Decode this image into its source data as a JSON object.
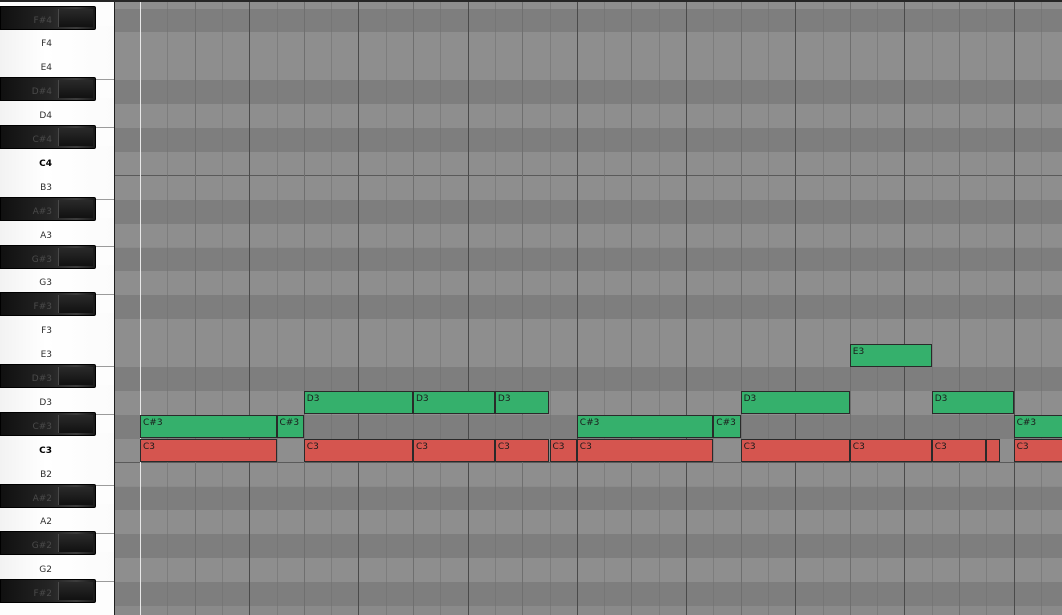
{
  "colors": {
    "note_green": "#35b06c",
    "note_red": "#d5554f",
    "grid_light": "#8e8e8e",
    "grid_dark": "#7e7e7e"
  },
  "keyboard": {
    "keys": [
      {
        "label": "F#4",
        "black": true
      },
      {
        "label": "F4",
        "black": false
      },
      {
        "label": "E4",
        "black": false
      },
      {
        "label": "D#4",
        "black": true
      },
      {
        "label": "D4",
        "black": false
      },
      {
        "label": "C#4",
        "black": true
      },
      {
        "label": "C4",
        "black": false
      },
      {
        "label": "B3",
        "black": false
      },
      {
        "label": "A#3",
        "black": true
      },
      {
        "label": "A3",
        "black": false
      },
      {
        "label": "G#3",
        "black": true
      },
      {
        "label": "G3",
        "black": false
      },
      {
        "label": "F#3",
        "black": true
      },
      {
        "label": "F3",
        "black": false
      },
      {
        "label": "E3",
        "black": false
      },
      {
        "label": "D#3",
        "black": true
      },
      {
        "label": "D3",
        "black": false
      },
      {
        "label": "C#3",
        "black": true
      },
      {
        "label": "C3",
        "black": false
      },
      {
        "label": "B2",
        "black": false
      },
      {
        "label": "A#2",
        "black": true
      },
      {
        "label": "A2",
        "black": false
      },
      {
        "label": "G#2",
        "black": true
      },
      {
        "label": "G2",
        "black": false
      },
      {
        "label": "F#2",
        "black": true
      }
    ]
  },
  "notes": [
    {
      "pitch": "E3",
      "start": 13,
      "length": 1.5,
      "color": "green"
    },
    {
      "pitch": "D3",
      "start": 3,
      "length": 2,
      "color": "green"
    },
    {
      "pitch": "D3",
      "start": 5,
      "length": 1.5,
      "color": "green"
    },
    {
      "pitch": "D3",
      "start": 6.5,
      "length": 1,
      "color": "green"
    },
    {
      "pitch": "D3",
      "start": 11,
      "length": 2,
      "color": "green"
    },
    {
      "pitch": "D3",
      "start": 14.5,
      "length": 1.5,
      "color": "green"
    },
    {
      "pitch": "C#3",
      "start": 0,
      "length": 2.5,
      "color": "green"
    },
    {
      "pitch": "C#3",
      "start": 2.5,
      "length": 0.5,
      "color": "green"
    },
    {
      "pitch": "C#3",
      "start": 8,
      "length": 2.5,
      "color": "green"
    },
    {
      "pitch": "C#3",
      "start": 10.5,
      "length": 0.5,
      "color": "green"
    },
    {
      "pitch": "C#3",
      "start": 16,
      "length": 1,
      "color": "green"
    },
    {
      "pitch": "C3",
      "start": 0,
      "length": 2.5,
      "color": "red"
    },
    {
      "pitch": "C3",
      "start": 3,
      "length": 2,
      "color": "red"
    },
    {
      "pitch": "C3",
      "start": 5,
      "length": 1.5,
      "color": "red"
    },
    {
      "pitch": "C3",
      "start": 6.5,
      "length": 1,
      "color": "red"
    },
    {
      "pitch": "C3",
      "start": 7.5,
      "length": 0.5,
      "color": "red"
    },
    {
      "pitch": "C3",
      "start": 8,
      "length": 2.5,
      "color": "red"
    },
    {
      "pitch": "C3",
      "start": 11,
      "length": 2,
      "color": "red"
    },
    {
      "pitch": "C3",
      "start": 13,
      "length": 1.5,
      "color": "red"
    },
    {
      "pitch": "C3",
      "start": 14.5,
      "length": 1,
      "color": "red"
    },
    {
      "pitch": "",
      "start": 15.5,
      "length": 0.25,
      "color": "red"
    },
    {
      "pitch": "C3",
      "start": 16,
      "length": 1,
      "color": "red"
    }
  ]
}
